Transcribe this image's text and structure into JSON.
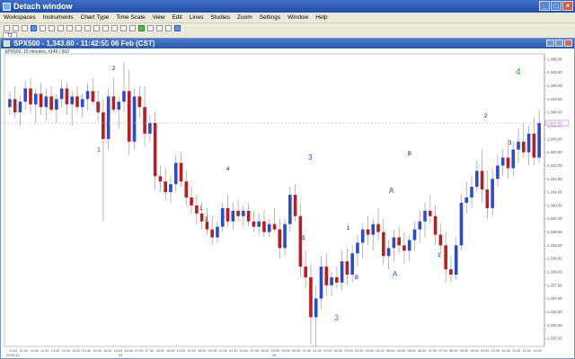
{
  "window": {
    "title": "Detach window"
  },
  "menu": [
    "Workspaces",
    "Instruments",
    "Chart Type",
    "Time Scale",
    "View",
    "Edit",
    "Lines",
    "Studies",
    "Zoom",
    "Settings",
    "Window",
    "Help"
  ],
  "tab": {
    "label": "T1"
  },
  "chart_window": {
    "title": "SPX500 - 1,343.60 - 11:42:55  06 Feb (CST)",
    "info": "SPX500, 15 minutes, #146 / 502"
  },
  "colors": {
    "up": "#2a4bd0",
    "down": "#c01a1a",
    "price_line": "#c060c0"
  },
  "chart_data": {
    "type": "candlestick",
    "symbol": "SPX500",
    "timeframe": "15 minutes",
    "last_price_label": "1,343.60",
    "y_ticks": [
      "1,346.00",
      "1,345.50",
      "1,345.00",
      "1,344.50",
      "1,344.00",
      "1,343.50",
      "1,343.00",
      "1,342.50",
      "1,342.00",
      "1,341.50",
      "1,341.00",
      "1,340.50",
      "1,340.00",
      "1,339.50",
      "1,339.00",
      "1,338.50",
      "1,338.00",
      "1,337.50",
      "1,337.00",
      "1,336.50",
      "1,336.00",
      "1,335.50"
    ],
    "x_ticks": [
      "11:00",
      "11:30",
      "12:00",
      "12:30",
      "13:00",
      "13:30",
      "14:00",
      "14:30",
      "15:00",
      "15:30",
      "16:00",
      "16:30",
      "17:00",
      "17:30",
      "18:00",
      "18:30",
      "19:00",
      "19:30",
      "20:00",
      "20:30",
      "21:00",
      "21:30",
      "22:00",
      "22:30",
      "23:00",
      "23:30",
      "00:00",
      "00:30",
      "01:00",
      "01:30",
      "02:00",
      "02:30",
      "03:00",
      "03:30",
      "04:00",
      "04:30",
      "05:00",
      "05:30",
      "06:00",
      "06:30",
      "07:00",
      "07:30",
      "08:00",
      "08:30",
      "09:00",
      "09:30",
      "10:00",
      "10:30",
      "11:00",
      "11:30",
      "12:00"
    ],
    "date_labels": [
      "02/03/12",
      "03",
      "06"
    ],
    "wave_labels": [
      "2",
      "2",
      "1",
      "1",
      "1",
      "3",
      "4",
      "3",
      "4",
      "3",
      "1",
      "A",
      "B",
      "A",
      "B",
      "1",
      "2",
      "3",
      "4",
      "2"
    ],
    "candles": [
      [
        1344.2,
        1344.8,
        1343.9,
        1344.5
      ],
      [
        1344.5,
        1345.0,
        1343.8,
        1344.0
      ],
      [
        1344.0,
        1344.6,
        1343.5,
        1344.4
      ],
      [
        1344.4,
        1345.2,
        1344.1,
        1344.9
      ],
      [
        1344.9,
        1345.3,
        1344.0,
        1344.3
      ],
      [
        1344.3,
        1344.9,
        1343.6,
        1344.7
      ],
      [
        1344.7,
        1345.1,
        1343.9,
        1344.2
      ],
      [
        1344.2,
        1344.9,
        1343.7,
        1344.6
      ],
      [
        1344.6,
        1345.0,
        1344.0,
        1344.1
      ],
      [
        1344.1,
        1344.7,
        1343.6,
        1344.5
      ],
      [
        1344.5,
        1345.2,
        1344.2,
        1344.9
      ],
      [
        1344.9,
        1345.1,
        1343.9,
        1344.3
      ],
      [
        1344.3,
        1344.8,
        1343.5,
        1344.6
      ],
      [
        1344.6,
        1345.0,
        1344.0,
        1344.2
      ],
      [
        1344.2,
        1344.7,
        1343.8,
        1344.5
      ],
      [
        1344.5,
        1345.1,
        1344.1,
        1344.8
      ],
      [
        1344.8,
        1345.3,
        1344.3,
        1344.4
      ],
      [
        1344.4,
        1344.8,
        1343.7,
        1344.0
      ],
      [
        1344.0,
        1344.5,
        1339.9,
        1343.0
      ],
      [
        1343.0,
        1344.9,
        1342.6,
        1344.6
      ],
      [
        1344.6,
        1345.3,
        1344.0,
        1344.1
      ],
      [
        1344.1,
        1344.6,
        1343.4,
        1344.4
      ],
      [
        1344.4,
        1345.9,
        1344.0,
        1344.8
      ],
      [
        1344.8,
        1345.6,
        1342.4,
        1342.9
      ],
      [
        1342.9,
        1344.9,
        1342.6,
        1344.6
      ],
      [
        1344.6,
        1345.0,
        1343.8,
        1344.2
      ],
      [
        1344.2,
        1345.0,
        1342.7,
        1343.2
      ],
      [
        1343.2,
        1343.9,
        1342.9,
        1343.6
      ],
      [
        1343.6,
        1344.0,
        1341.1,
        1341.6
      ],
      [
        1341.6,
        1342.0,
        1341.0,
        1341.4
      ],
      [
        1341.4,
        1341.9,
        1340.7,
        1341.0
      ],
      [
        1341.0,
        1341.6,
        1340.6,
        1341.3
      ],
      [
        1341.3,
        1342.4,
        1341.0,
        1342.1
      ],
      [
        1342.1,
        1342.5,
        1341.2,
        1341.4
      ],
      [
        1341.4,
        1341.8,
        1340.5,
        1340.8
      ],
      [
        1340.8,
        1341.2,
        1340.2,
        1340.5
      ],
      [
        1340.5,
        1340.9,
        1339.8,
        1340.2
      ],
      [
        1340.2,
        1340.6,
        1339.6,
        1339.9
      ],
      [
        1339.9,
        1340.4,
        1339.4,
        1339.6
      ],
      [
        1339.6,
        1340.1,
        1339.0,
        1339.3
      ],
      [
        1339.3,
        1339.9,
        1339.1,
        1339.7
      ],
      [
        1339.7,
        1340.6,
        1339.5,
        1340.4
      ],
      [
        1340.4,
        1340.9,
        1339.7,
        1339.9
      ],
      [
        1339.9,
        1340.6,
        1339.6,
        1340.3
      ],
      [
        1340.3,
        1340.7,
        1339.9,
        1340.1
      ],
      [
        1340.1,
        1340.5,
        1339.7,
        1340.3
      ],
      [
        1340.3,
        1340.6,
        1339.7,
        1339.9
      ],
      [
        1339.9,
        1340.3,
        1339.5,
        1339.7
      ],
      [
        1339.7,
        1340.2,
        1339.4,
        1339.9
      ],
      [
        1339.9,
        1340.3,
        1339.3,
        1339.5
      ],
      [
        1339.5,
        1340.0,
        1339.3,
        1339.8
      ],
      [
        1339.8,
        1340.4,
        1339.5,
        1339.6
      ],
      [
        1339.6,
        1340.0,
        1338.5,
        1338.9
      ],
      [
        1338.9,
        1340.0,
        1338.6,
        1339.8
      ],
      [
        1339.8,
        1341.2,
        1339.5,
        1340.9
      ],
      [
        1340.9,
        1341.3,
        1339.9,
        1340.1
      ],
      [
        1340.1,
        1340.6,
        1337.8,
        1338.2
      ],
      [
        1338.2,
        1338.8,
        1337.4,
        1337.8
      ],
      [
        1337.8,
        1338.3,
        1335.3,
        1336.3
      ],
      [
        1336.3,
        1337.5,
        1335.2,
        1337.0
      ],
      [
        1337.0,
        1338.6,
        1336.6,
        1338.2
      ],
      [
        1338.2,
        1338.7,
        1337.1,
        1337.5
      ],
      [
        1337.5,
        1338.0,
        1337.1,
        1337.8
      ],
      [
        1337.8,
        1338.2,
        1337.4,
        1337.6
      ],
      [
        1337.6,
        1338.8,
        1337.3,
        1338.4
      ],
      [
        1338.4,
        1338.9,
        1337.5,
        1337.9
      ],
      [
        1337.9,
        1339.0,
        1337.6,
        1338.7
      ],
      [
        1338.7,
        1339.4,
        1338.2,
        1339.1
      ],
      [
        1339.1,
        1339.8,
        1338.5,
        1339.6
      ],
      [
        1339.6,
        1340.1,
        1339.0,
        1339.4
      ],
      [
        1339.4,
        1340.0,
        1338.8,
        1339.8
      ],
      [
        1339.8,
        1340.4,
        1339.2,
        1339.5
      ],
      [
        1339.5,
        1340.0,
        1338.3,
        1338.6
      ],
      [
        1338.6,
        1339.2,
        1338.1,
        1338.9
      ],
      [
        1338.9,
        1339.6,
        1338.4,
        1339.3
      ],
      [
        1339.3,
        1339.7,
        1338.7,
        1339.0
      ],
      [
        1339.0,
        1339.5,
        1338.3,
        1338.8
      ],
      [
        1338.8,
        1339.4,
        1338.4,
        1339.2
      ],
      [
        1339.2,
        1339.9,
        1338.8,
        1339.6
      ],
      [
        1339.6,
        1340.3,
        1339.1,
        1339.9
      ],
      [
        1339.9,
        1340.6,
        1339.3,
        1340.3
      ],
      [
        1340.3,
        1340.9,
        1339.8,
        1340.1
      ],
      [
        1340.1,
        1340.5,
        1339.0,
        1339.4
      ],
      [
        1339.4,
        1339.8,
        1338.6,
        1339.0
      ],
      [
        1339.0,
        1339.5,
        1337.6,
        1338.1
      ],
      [
        1338.1,
        1338.6,
        1337.6,
        1337.9
      ],
      [
        1337.9,
        1339.3,
        1337.7,
        1339.0
      ],
      [
        1339.0,
        1340.9,
        1338.8,
        1340.6
      ],
      [
        1340.6,
        1341.4,
        1340.2,
        1340.8
      ],
      [
        1340.8,
        1341.6,
        1340.4,
        1341.2
      ],
      [
        1341.2,
        1342.2,
        1341.0,
        1341.8
      ],
      [
        1341.8,
        1342.6,
        1340.6,
        1341.1
      ],
      [
        1341.1,
        1341.8,
        1340.0,
        1340.4
      ],
      [
        1340.4,
        1341.9,
        1340.1,
        1341.5
      ],
      [
        1341.5,
        1342.4,
        1341.2,
        1342.0
      ],
      [
        1342.0,
        1342.6,
        1341.6,
        1342.3
      ],
      [
        1342.3,
        1343.0,
        1341.5,
        1341.9
      ],
      [
        1341.9,
        1342.9,
        1341.6,
        1342.6
      ],
      [
        1342.6,
        1343.4,
        1342.1,
        1342.9
      ],
      [
        1342.9,
        1343.6,
        1342.3,
        1342.5
      ],
      [
        1342.5,
        1343.5,
        1342.0,
        1343.2
      ],
      [
        1343.2,
        1343.8,
        1342.0,
        1342.3
      ],
      [
        1342.3,
        1344.1,
        1342.1,
        1343.6
      ]
    ]
  }
}
